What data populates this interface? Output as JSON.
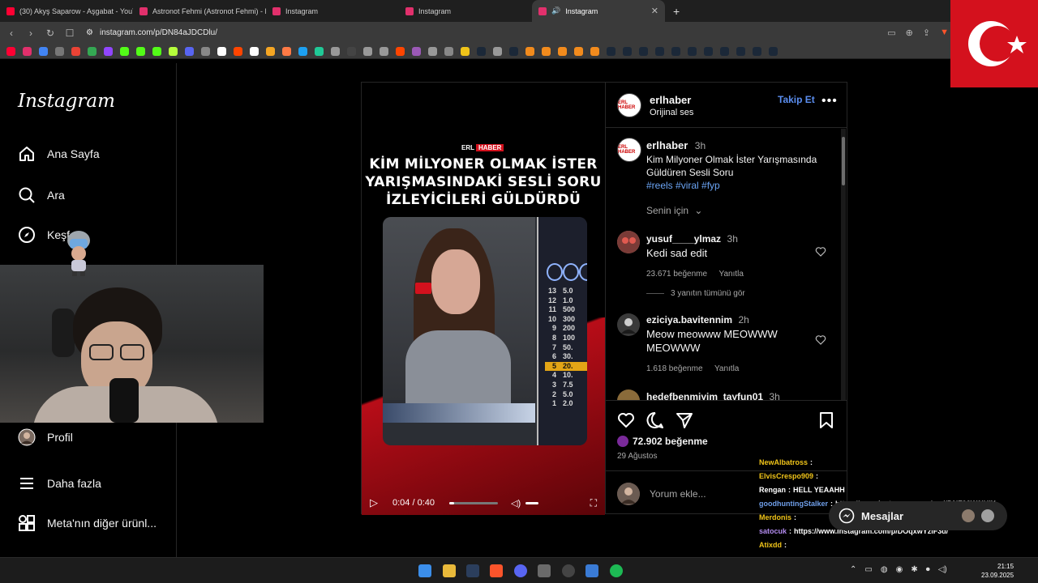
{
  "browser": {
    "tabs": [
      {
        "label": "(30) Akyş Saparow - Aşgabat - YouTube",
        "color": "#ff0033"
      },
      {
        "label": "Astronot Fehmi (Astronot Fehmi) - Fi",
        "color": "#e1306c"
      },
      {
        "label": "Instagram",
        "color": "#e1306c"
      },
      {
        "label": "Instagram",
        "color": "#e1306c"
      },
      {
        "label": "Instagram",
        "color": "#e1306c"
      }
    ],
    "new_tab_symbol": "+",
    "url": "instagram.com/p/DN84aJDCDlu/"
  },
  "sidebar": {
    "logo": "Instagram",
    "items": [
      {
        "label": "Ana Sayfa",
        "icon": "home-icon"
      },
      {
        "label": "Ara",
        "icon": "search-icon"
      },
      {
        "label": "Keşfet",
        "icon": "compass-icon"
      },
      {
        "label": "Profil",
        "icon": "avatar"
      },
      {
        "label": "Daha fazla",
        "icon": "menu-icon"
      },
      {
        "label": "Meta'nın diğer ürünl...",
        "icon": "apps-icon"
      }
    ],
    "explore_visible": "Keşf"
  },
  "video": {
    "brand_erl": "ERL",
    "brand_haber": "HABER",
    "headline": [
      "KİM MİLYONER OLMAK İSTER",
      "YARIŞMASINDAKİ SESLİ SORU",
      "İZLEYİCİLERİ GÜLDÜRDÜ"
    ],
    "ladder": [
      {
        "n": "13",
        "v": "5.0"
      },
      {
        "n": "12",
        "v": "1.0"
      },
      {
        "n": "11",
        "v": "500"
      },
      {
        "n": "10",
        "v": "300"
      },
      {
        "n": "9",
        "v": "200"
      },
      {
        "n": "8",
        "v": "100"
      },
      {
        "n": "7",
        "v": "50."
      },
      {
        "n": "6",
        "v": "30."
      },
      {
        "n": "5",
        "v": "20."
      },
      {
        "n": "4",
        "v": "10."
      },
      {
        "n": "3",
        "v": "7.5"
      },
      {
        "n": "2",
        "v": "5.0"
      },
      {
        "n": "1",
        "v": "2.0"
      }
    ],
    "time": "0:04 / 0:40",
    "progress": 0.1
  },
  "post": {
    "author": "erlhaber",
    "audio": "Orijinal ses",
    "follow": "Takip Et",
    "more": "•••",
    "avatar_text": "ERL HABER",
    "caption_time": "3h",
    "caption": "Kim Milyoner Olmak İster Yarışmasında Güldüren Sesli Soru",
    "hashtags": "#reels #viral #fyp",
    "sort": "Senin için",
    "likes": "72.902 beğenme",
    "date": "29 Ağustos",
    "add_comment": "Yorum ekle..."
  },
  "comments": [
    {
      "user": "yusuf____ylmaz",
      "time": "3h",
      "text": "Kedi sad edit",
      "likes": "23.671 beğenme",
      "reply": "Yanıtla",
      "replies": "3 yanıtın tümünü gör"
    },
    {
      "user": "eziciya.bavitennim",
      "time": "2h",
      "text": "Meow meowww MEOWWW MEOWWW",
      "likes": "1.618 beğenme",
      "reply": "Yanıtla"
    },
    {
      "user": "hedefbenmiyim_tayfun01",
      "time": "3h"
    }
  ],
  "chat": [
    {
      "user": "NewAlbatross",
      "color": "#f0c419",
      "text": ""
    },
    {
      "user": "ElvisCrespo909",
      "color": "#f0c419",
      "text": ""
    },
    {
      "user": "Rengan",
      "color": "#ffffff",
      "text": "HELL YEAAHH"
    },
    {
      "user": "goodhuntingStalker",
      "color": "#6f9ee8",
      "text": "https://www.instagram.com/reel/DNF92W0IHIX"
    },
    {
      "user": "Merdonis",
      "color": "#f0c419",
      "text": ""
    },
    {
      "user": "satocuk",
      "color": "#b38cf0",
      "text": "https://www.instagram.com/p/DOqxwYziF3d/"
    },
    {
      "user": "Atixdd",
      "color": "#f0c419",
      "text": ""
    }
  ],
  "messages_button": "Mesajlar",
  "taskbar": {
    "time": "21:15",
    "date": "23.09.2025"
  },
  "colors": {
    "accent_blue": "#5b8ef0",
    "brand_red": "#d4111d",
    "background": "#000000"
  }
}
